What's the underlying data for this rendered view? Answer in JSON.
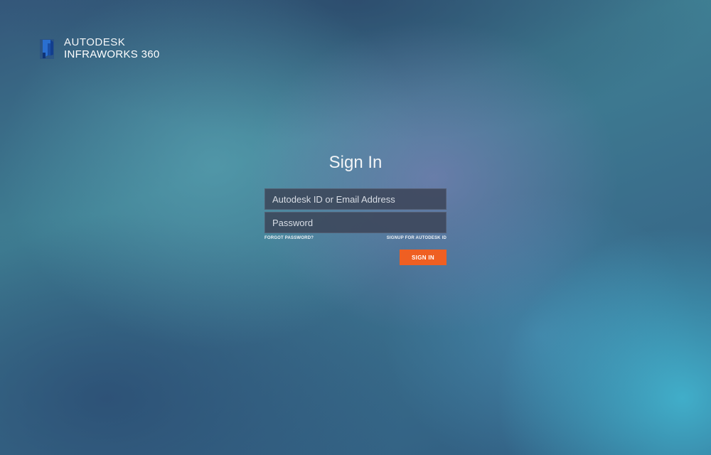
{
  "branding": {
    "company": "AUTODESK",
    "product": "INFRAWORKS 360",
    "logo_icon": "infraworks-logo-icon"
  },
  "signin": {
    "title": "Sign In",
    "email_placeholder": "Autodesk ID or Email Address",
    "email_value": "",
    "password_placeholder": "Password",
    "password_value": "",
    "forgot_password_label": "FORGOT PASSWORD?",
    "signup_label": "SIGNUP FOR AUTODESK ID",
    "submit_label": "SIGN IN"
  },
  "colors": {
    "accent_button": "#ef5f22",
    "field_background": "#3a4254",
    "background_primary": "#3f7f93"
  }
}
